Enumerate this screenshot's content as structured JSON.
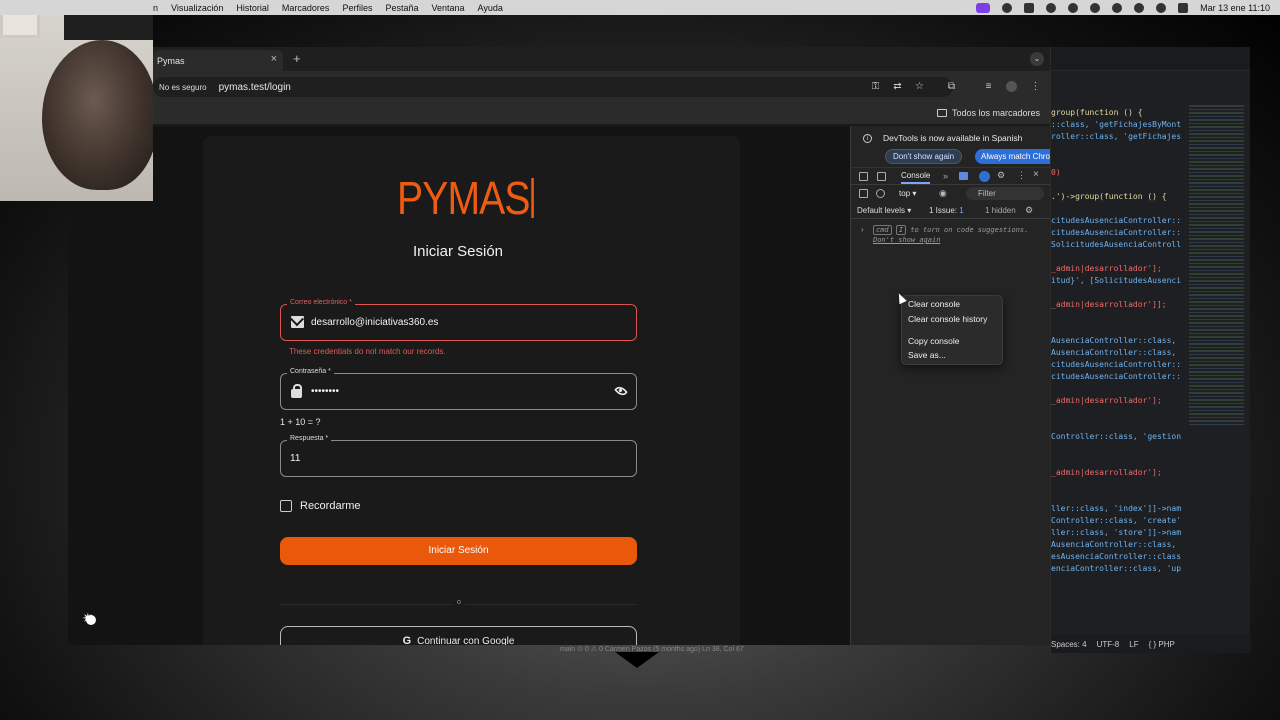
{
  "menubar": {
    "items": [
      "n",
      "Visualización",
      "Historial",
      "Marcadores",
      "Perfiles",
      "Pestaña",
      "Ventana",
      "Ayuda"
    ],
    "clock": "Mar 13 ene 11:10"
  },
  "browser": {
    "tab_title": "Pymas",
    "security_label": "No es seguro",
    "url": "pymas.test/login",
    "all_bookmarks": "Todos los marcadores"
  },
  "page": {
    "logo": "PYMAS",
    "title": "Iniciar Sesión",
    "email": {
      "label": "Correo electrónico *",
      "value": "desarrollo@iniciativas360.es"
    },
    "error": "These credentials do not match our records.",
    "password": {
      "label": "Contraseña *",
      "value": "••••••••"
    },
    "captcha_question": "1 + 10 = ?",
    "answer": {
      "label": "Respuesta *",
      "value": "11"
    },
    "remember": "Recordarme",
    "submit": "Iniciar Sesión",
    "divider": "o",
    "google": "Continuar con Google"
  },
  "devtools": {
    "banner": "DevTools is now available in Spanish",
    "dont_show": "Don't show again",
    "always_match": "Always match Chrome",
    "console_tab": "Console",
    "context_top": "top",
    "filter": "Filter",
    "default_levels": "Default levels",
    "issues": "1 Issue:",
    "issues_count": "1",
    "hidden": "1 hidden",
    "hint_key1": "cmd",
    "hint_key2": "I",
    "hint_text": "to turn on code suggestions.",
    "hint_link": "Don't show again"
  },
  "context_menu": [
    "Clear console",
    "Clear console history",
    "Copy console",
    "Save as..."
  ],
  "editor": {
    "lines": [
      {
        "t": "group(function () {",
        "c": "cw"
      },
      {
        "t": "::class, 'getFichajesByMont",
        "c": "cb"
      },
      {
        "t": "roller::class, 'getFichajesM",
        "c": "cb"
      },
      {
        "t": "",
        "c": "cw"
      },
      {
        "t": "",
        "c": "cw"
      },
      {
        "t": "0)",
        "c": "cr"
      },
      {
        "t": "",
        "c": "cw"
      },
      {
        "t": ".')->group(function () {",
        "c": "cw"
      },
      {
        "t": "",
        "c": "cw"
      },
      {
        "t": "citudesAusenciaController::c",
        "c": "cb"
      },
      {
        "t": "citudesAusenciaController::cla",
        "c": "cb"
      },
      {
        "t": "SolicitudesAusenciaController",
        "c": "cb"
      },
      {
        "t": "",
        "c": "cw"
      },
      {
        "t": "_admin|desarrollador'];",
        "c": "cr"
      },
      {
        "t": "itud}', [SolicitudesAusencia",
        "c": "cb"
      },
      {
        "t": "",
        "c": "cw"
      },
      {
        "t": "_admin|desarrollador']];",
        "c": "cr"
      },
      {
        "t": "",
        "c": "cw"
      },
      {
        "t": "",
        "c": "cw"
      },
      {
        "t": "AusenciaController::class,",
        "c": "cb"
      },
      {
        "t": "AusenciaController::class, 'ge",
        "c": "cb"
      },
      {
        "t": "citudesAusenciaController::cl",
        "c": "cb"
      },
      {
        "t": "citudesAusenciaController::cla",
        "c": "cb"
      },
      {
        "t": "",
        "c": "cw"
      },
      {
        "t": "_admin|desarrollador'];",
        "c": "cr"
      },
      {
        "t": "",
        "c": "cw"
      },
      {
        "t": "",
        "c": "cw"
      },
      {
        "t": "Controller::class, 'gestion",
        "c": "cb"
      },
      {
        "t": "",
        "c": "cw"
      },
      {
        "t": "",
        "c": "cw"
      },
      {
        "t": "_admin|desarrollador'];",
        "c": "cr"
      },
      {
        "t": "",
        "c": "cw"
      },
      {
        "t": "",
        "c": "cw"
      },
      {
        "t": "ller::class, 'index']]->name",
        "c": "cb"
      },
      {
        "t": "Controller::class, 'create']",
        "c": "cb"
      },
      {
        "t": "ller::class, 'store']]->nam",
        "c": "cb"
      },
      {
        "t": "AusenciaController::class, 'sho",
        "c": "cb"
      },
      {
        "t": "esAusenciaController::class,",
        "c": "cb"
      },
      {
        "t": "enciaController::class, 'upd",
        "c": "cb"
      },
      {
        "t": "",
        "c": "cw"
      },
      {
        "t": "",
        "c": "cw"
      },
      {
        "t": "",
        "c": "cw"
      },
      {
        "t": "",
        "c": "cw"
      },
      {
        "t": "",
        "c": "cw"
      },
      {
        "t": "group(function () {",
        "c": "cw"
      }
    ],
    "status": [
      "Spaces: 4",
      "UTF-8",
      "LF",
      "{ } PHP"
    ],
    "dock_text": "main  ⊙ 0 ⚠ 0    Carmen Pazos (5 months ago)   Ln 38, Col 67"
  },
  "colors": {
    "accent": "#ea580c",
    "error": "#e05252"
  }
}
